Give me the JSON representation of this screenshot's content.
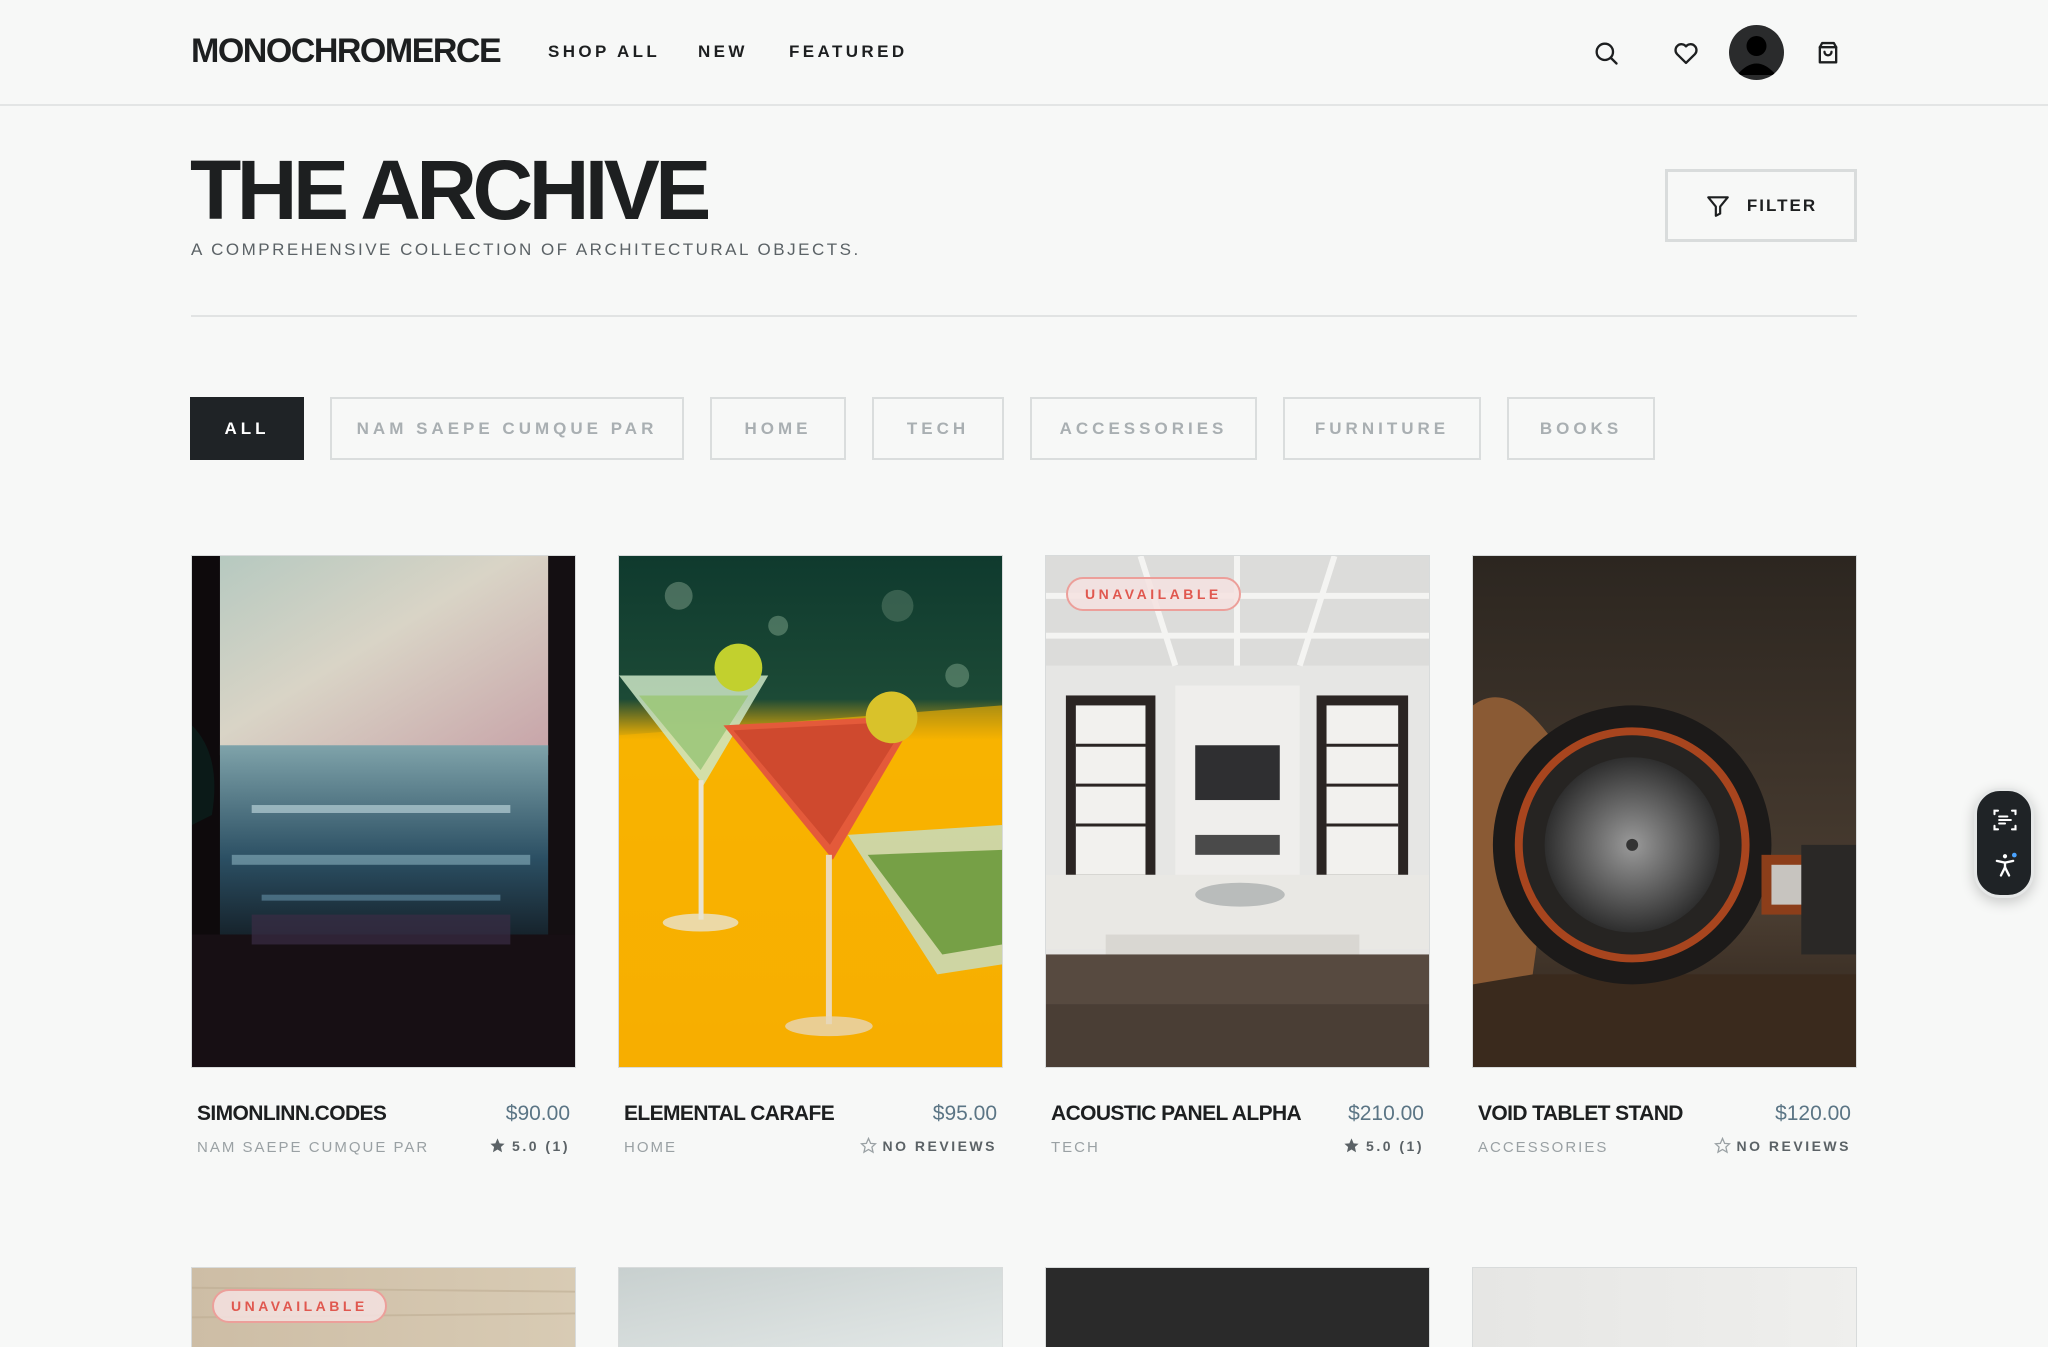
{
  "header": {
    "logo": "MONOCHROMERCE",
    "nav": [
      "SHOP ALL",
      "NEW",
      "FEATURED"
    ],
    "icons": [
      "search-icon",
      "heart-icon",
      "avatar",
      "cart-icon"
    ]
  },
  "page": {
    "title": "THE ARCHIVE",
    "subtitle": "A COMPREHENSIVE COLLECTION OF ARCHITECTURAL OBJECTS.",
    "filter_label": "FILTER"
  },
  "categories": [
    "ALL",
    "NAM SAEPE CUMQUE PAR",
    "HOME",
    "TECH",
    "ACCESSORIES",
    "FURNITURE",
    "BOOKS"
  ],
  "active_category": "ALL",
  "products": [
    {
      "name": "SIMONLINN.CODES",
      "price": "$90.00",
      "category": "NAM SAEPE CUMQUE PAR",
      "rating": "5.0 (1)",
      "rated": true
    },
    {
      "name": "ELEMENTAL CARAFE",
      "price": "$95.00",
      "category": "HOME",
      "rating": "NO REVIEWS",
      "rated": false
    },
    {
      "name": "ACOUSTIC PANEL ALPHA",
      "price": "$210.00",
      "category": "TECH",
      "rating": "5.0 (1)",
      "rated": true,
      "badge": "UNAVAILABLE"
    },
    {
      "name": "VOID TABLET STAND",
      "price": "$120.00",
      "category": "ACCESSORIES",
      "rating": "NO REVIEWS",
      "rated": false
    }
  ],
  "second_row": [
    {
      "badge": "UNAVAILABLE"
    }
  ],
  "colors": {
    "accent_dark": "#1f2326",
    "price": "#5b7585",
    "badge_red": "#e0584f",
    "background": "#f7f8f7"
  }
}
